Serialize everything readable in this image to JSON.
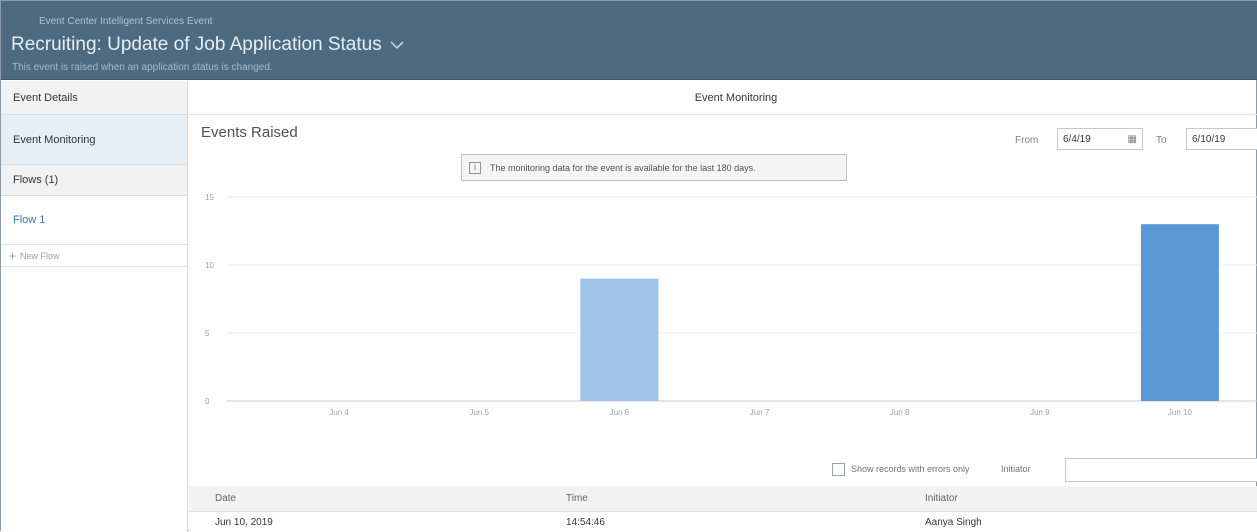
{
  "header": {
    "breadcrumb": "Event Center Intelligent Services Event",
    "title": "Recruiting: Update of Job Application Status",
    "subtitle": "This event is raised when an application status is changed."
  },
  "sidebar": {
    "items": [
      {
        "label": "Event Details"
      },
      {
        "label": "Event Monitoring"
      },
      {
        "label": "Flows (1)"
      },
      {
        "label": "Flow 1"
      },
      {
        "label": "New Flow"
      }
    ]
  },
  "main": {
    "tab_title": "Event Monitoring",
    "section_title": "Events Raised",
    "info_text": "The monitoring data for the event is available for the last 180 days.",
    "from_label": "From",
    "from_value": "6/4/19",
    "to_label": "To",
    "to_value": "6/10/19",
    "errors_only_label": "Show records with errors only",
    "initiator_label": "Initiator",
    "table": {
      "columns": [
        "Date",
        "Time",
        "Initiator"
      ],
      "rows": [
        [
          "Jun 10, 2019",
          "14:54:46",
          "Aanya Singh"
        ]
      ]
    }
  },
  "colors": {
    "header_bg": "#4d6a80",
    "bar_light": "#9fc3e9",
    "bar_dark": "#5a99d6",
    "link": "#3a78b0"
  },
  "chart_data": {
    "type": "bar",
    "categories": [
      "Jun 4",
      "Jun 5",
      "Jun 6",
      "Jun 7",
      "Jun 8",
      "Jun 9",
      "Jun 10"
    ],
    "values": [
      0,
      0,
      9,
      0,
      0,
      0,
      13
    ],
    "yticks": [
      0,
      5,
      10,
      15
    ],
    "ylim": [
      0,
      15
    ],
    "grid": true
  }
}
